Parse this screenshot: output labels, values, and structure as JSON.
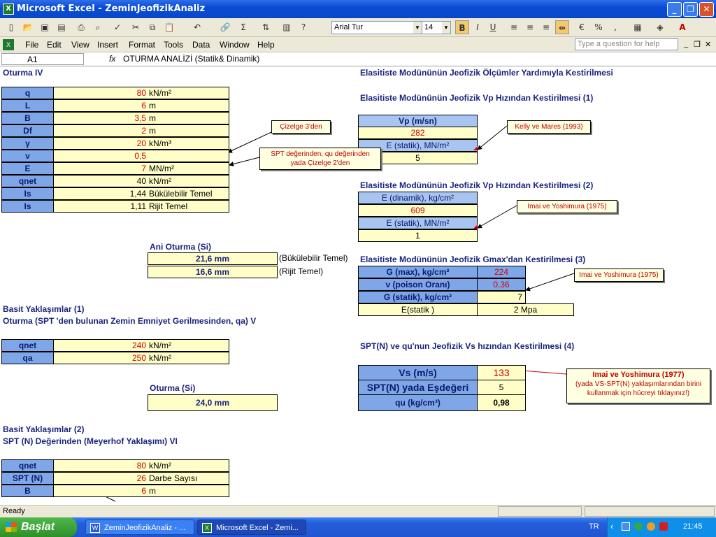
{
  "window": {
    "title": "Microsoft Excel - ZeminJeofizikAnaliz",
    "app_icon": "excel-icon"
  },
  "toolbar": {
    "font": "Arial Tur",
    "size": "14"
  },
  "menu": [
    "File",
    "Edit",
    "View",
    "Insert",
    "Format",
    "Tools",
    "Data",
    "Window",
    "Help"
  ],
  "ask": {
    "placeholder": "Type a question for help"
  },
  "formula": {
    "cell": "A1",
    "fx": "fx",
    "value": "OTURMA ANALİZİ (Statik& Dinamik)"
  },
  "left": {
    "title1": "Oturma IV",
    "params": [
      {
        "label": "q",
        "value": "80",
        "unit": "kN/m²",
        "red": true
      },
      {
        "label": "L",
        "value": "6",
        "unit": "m",
        "red": true
      },
      {
        "label": "B",
        "value": "3,5",
        "unit": "m",
        "red": true
      },
      {
        "label": "Df",
        "value": "2",
        "unit": "m",
        "red": true
      },
      {
        "label": "γ",
        "value": "20",
        "unit": "kN/m³",
        "red": true
      },
      {
        "label": "ν",
        "value": "0,5",
        "unit": "",
        "red": true
      },
      {
        "label": "E",
        "value": "7",
        "unit": "MN/m²",
        "red": true
      },
      {
        "label": "qnet",
        "value": "40",
        "unit": "kN/m²",
        "red": false
      },
      {
        "label": "Is",
        "value": "1,44",
        "unit": "Bükülebilir Temel",
        "red": false
      },
      {
        "label": "Is",
        "value": "1,11",
        "unit": "Rijit Temel",
        "red": false
      }
    ],
    "ani_title": "Ani Oturma (Si)",
    "ani": [
      {
        "value": "21,6 mm",
        "note": "(Bükülebilir Temel)"
      },
      {
        "value": "16,6 mm",
        "note": "(Rijit Temel)"
      }
    ],
    "basit1_title1": "Basit Yaklaşımlar (1)",
    "basit1_title2": "Oturma (SPT 'den bulunan  Zemin Emniyet Gerilmesinden, qa) V",
    "basit1": [
      {
        "label": "qnet",
        "value": "240",
        "unit": "kN/m²"
      },
      {
        "label": "qa",
        "value": "250",
        "unit": "kN/m²"
      }
    ],
    "oturma_title": "Oturma (Si)",
    "oturma_value": "24,0 mm",
    "basit2_title1": "Basit Yaklaşımlar (2)",
    "basit2_title2": "SPT  (N) Değerinden (Meyerhof Yaklaşımı) VI",
    "basit2": [
      {
        "label": "qnet",
        "value": "80",
        "unit": "kN/m²"
      },
      {
        "label": "SPT (N)",
        "value": "26",
        "unit": "Darbe Sayısı"
      },
      {
        "label": "B",
        "value": "6",
        "unit": "m"
      }
    ]
  },
  "right": {
    "main_title": "Elasitiste Modününün Jeofizik Ölçümler Yardımıyla Kestirilmesi",
    "s1_title": "Elasitiste Modününün Jeofizik Vp Hızından Kestirilmesi (1)",
    "s1": {
      "h1": "Vp (m/sn)",
      "v1": "282",
      "h2": "E (statik), MN/m²",
      "v2": "5"
    },
    "s2_title": "Elasitiste Modününün Jeofizik Vp Hızından Kestirilmesi (2)",
    "s2": {
      "h1": "E (dinamik), kg/cm²",
      "v1": "609",
      "h2": "E (statik), MN/m²",
      "v2": "1"
    },
    "s3_title": "Elasitiste Modününün Jeofizik Gmax'dan Kestirilmesi (3)",
    "s3": [
      {
        "label": "G (max), kg/cm²",
        "value": "224"
      },
      {
        "label": "ν (poison Oranı)",
        "value": "0,36"
      },
      {
        "label": "G (statik), kg/cm²",
        "value": "7"
      },
      {
        "label": "E(statik )",
        "value": "2 Mpa"
      }
    ],
    "s4_title": "SPT(N) ve qu'nun Jeofizik Vs hızından Kestirilmesi (4)",
    "s4": [
      {
        "label": "Vs (m/s)",
        "value": "133"
      },
      {
        "label": "SPT(N) yada Eşdeğeri",
        "value": "5"
      },
      {
        "label": "qu (kg/cm³)",
        "value": "0,98"
      }
    ]
  },
  "notes": {
    "cizelge3": "Çizelge 3'den",
    "spt": "SPT değerinden,  qu değerinden yada Çizelge 2'den",
    "kelly": "Kelly ve Mares (1993)",
    "imai1": "Imai ve Yoshimura (1975)",
    "imai2": "Imai ve Yoshimura (1975)",
    "imai3_title": "Imai ve Yoshimura (1977)",
    "imai3_body": "(yada VS-SPT(N) yaklaşımlarından birini kullanmak için hücreyi tıklayınız!)"
  },
  "status": "Ready",
  "taskbar": {
    "start": "Başlat",
    "task1": "ZeminJeofizikAnaliz - ...",
    "task2": "Microsoft Excel - Zemi...",
    "lang": "TR",
    "time": "21:45"
  }
}
